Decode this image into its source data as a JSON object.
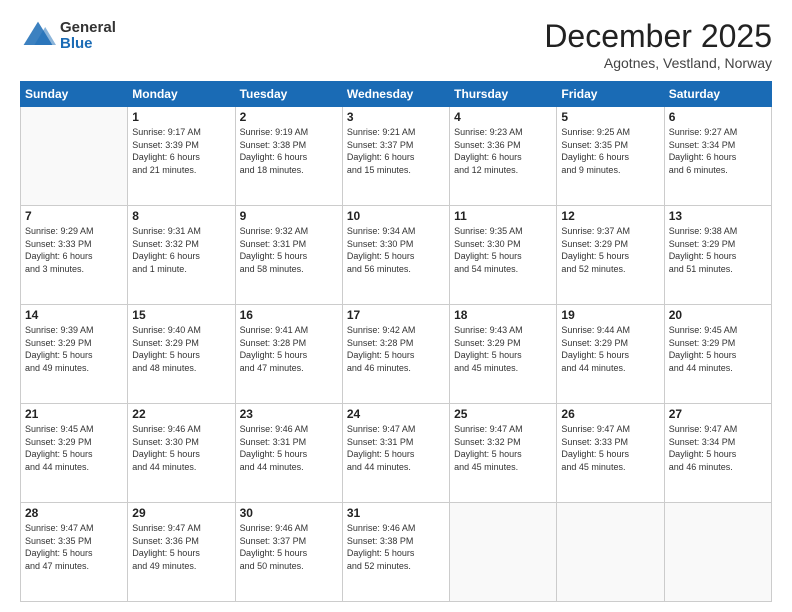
{
  "header": {
    "logo": {
      "general": "General",
      "blue": "Blue"
    },
    "month": "December 2025",
    "location": "Agotnes, Vestland, Norway"
  },
  "weekdays": [
    "Sunday",
    "Monday",
    "Tuesday",
    "Wednesday",
    "Thursday",
    "Friday",
    "Saturday"
  ],
  "weeks": [
    [
      {
        "day": "",
        "info": ""
      },
      {
        "day": "1",
        "info": "Sunrise: 9:17 AM\nSunset: 3:39 PM\nDaylight: 6 hours\nand 21 minutes."
      },
      {
        "day": "2",
        "info": "Sunrise: 9:19 AM\nSunset: 3:38 PM\nDaylight: 6 hours\nand 18 minutes."
      },
      {
        "day": "3",
        "info": "Sunrise: 9:21 AM\nSunset: 3:37 PM\nDaylight: 6 hours\nand 15 minutes."
      },
      {
        "day": "4",
        "info": "Sunrise: 9:23 AM\nSunset: 3:36 PM\nDaylight: 6 hours\nand 12 minutes."
      },
      {
        "day": "5",
        "info": "Sunrise: 9:25 AM\nSunset: 3:35 PM\nDaylight: 6 hours\nand 9 minutes."
      },
      {
        "day": "6",
        "info": "Sunrise: 9:27 AM\nSunset: 3:34 PM\nDaylight: 6 hours\nand 6 minutes."
      }
    ],
    [
      {
        "day": "7",
        "info": "Sunrise: 9:29 AM\nSunset: 3:33 PM\nDaylight: 6 hours\nand 3 minutes."
      },
      {
        "day": "8",
        "info": "Sunrise: 9:31 AM\nSunset: 3:32 PM\nDaylight: 6 hours\nand 1 minute."
      },
      {
        "day": "9",
        "info": "Sunrise: 9:32 AM\nSunset: 3:31 PM\nDaylight: 5 hours\nand 58 minutes."
      },
      {
        "day": "10",
        "info": "Sunrise: 9:34 AM\nSunset: 3:30 PM\nDaylight: 5 hours\nand 56 minutes."
      },
      {
        "day": "11",
        "info": "Sunrise: 9:35 AM\nSunset: 3:30 PM\nDaylight: 5 hours\nand 54 minutes."
      },
      {
        "day": "12",
        "info": "Sunrise: 9:37 AM\nSunset: 3:29 PM\nDaylight: 5 hours\nand 52 minutes."
      },
      {
        "day": "13",
        "info": "Sunrise: 9:38 AM\nSunset: 3:29 PM\nDaylight: 5 hours\nand 51 minutes."
      }
    ],
    [
      {
        "day": "14",
        "info": "Sunrise: 9:39 AM\nSunset: 3:29 PM\nDaylight: 5 hours\nand 49 minutes."
      },
      {
        "day": "15",
        "info": "Sunrise: 9:40 AM\nSunset: 3:29 PM\nDaylight: 5 hours\nand 48 minutes."
      },
      {
        "day": "16",
        "info": "Sunrise: 9:41 AM\nSunset: 3:28 PM\nDaylight: 5 hours\nand 47 minutes."
      },
      {
        "day": "17",
        "info": "Sunrise: 9:42 AM\nSunset: 3:28 PM\nDaylight: 5 hours\nand 46 minutes."
      },
      {
        "day": "18",
        "info": "Sunrise: 9:43 AM\nSunset: 3:29 PM\nDaylight: 5 hours\nand 45 minutes."
      },
      {
        "day": "19",
        "info": "Sunrise: 9:44 AM\nSunset: 3:29 PM\nDaylight: 5 hours\nand 44 minutes."
      },
      {
        "day": "20",
        "info": "Sunrise: 9:45 AM\nSunset: 3:29 PM\nDaylight: 5 hours\nand 44 minutes."
      }
    ],
    [
      {
        "day": "21",
        "info": "Sunrise: 9:45 AM\nSunset: 3:29 PM\nDaylight: 5 hours\nand 44 minutes."
      },
      {
        "day": "22",
        "info": "Sunrise: 9:46 AM\nSunset: 3:30 PM\nDaylight: 5 hours\nand 44 minutes."
      },
      {
        "day": "23",
        "info": "Sunrise: 9:46 AM\nSunset: 3:31 PM\nDaylight: 5 hours\nand 44 minutes."
      },
      {
        "day": "24",
        "info": "Sunrise: 9:47 AM\nSunset: 3:31 PM\nDaylight: 5 hours\nand 44 minutes."
      },
      {
        "day": "25",
        "info": "Sunrise: 9:47 AM\nSunset: 3:32 PM\nDaylight: 5 hours\nand 45 minutes."
      },
      {
        "day": "26",
        "info": "Sunrise: 9:47 AM\nSunset: 3:33 PM\nDaylight: 5 hours\nand 45 minutes."
      },
      {
        "day": "27",
        "info": "Sunrise: 9:47 AM\nSunset: 3:34 PM\nDaylight: 5 hours\nand 46 minutes."
      }
    ],
    [
      {
        "day": "28",
        "info": "Sunrise: 9:47 AM\nSunset: 3:35 PM\nDaylight: 5 hours\nand 47 minutes."
      },
      {
        "day": "29",
        "info": "Sunrise: 9:47 AM\nSunset: 3:36 PM\nDaylight: 5 hours\nand 49 minutes."
      },
      {
        "day": "30",
        "info": "Sunrise: 9:46 AM\nSunset: 3:37 PM\nDaylight: 5 hours\nand 50 minutes."
      },
      {
        "day": "31",
        "info": "Sunrise: 9:46 AM\nSunset: 3:38 PM\nDaylight: 5 hours\nand 52 minutes."
      },
      {
        "day": "",
        "info": ""
      },
      {
        "day": "",
        "info": ""
      },
      {
        "day": "",
        "info": ""
      }
    ]
  ]
}
